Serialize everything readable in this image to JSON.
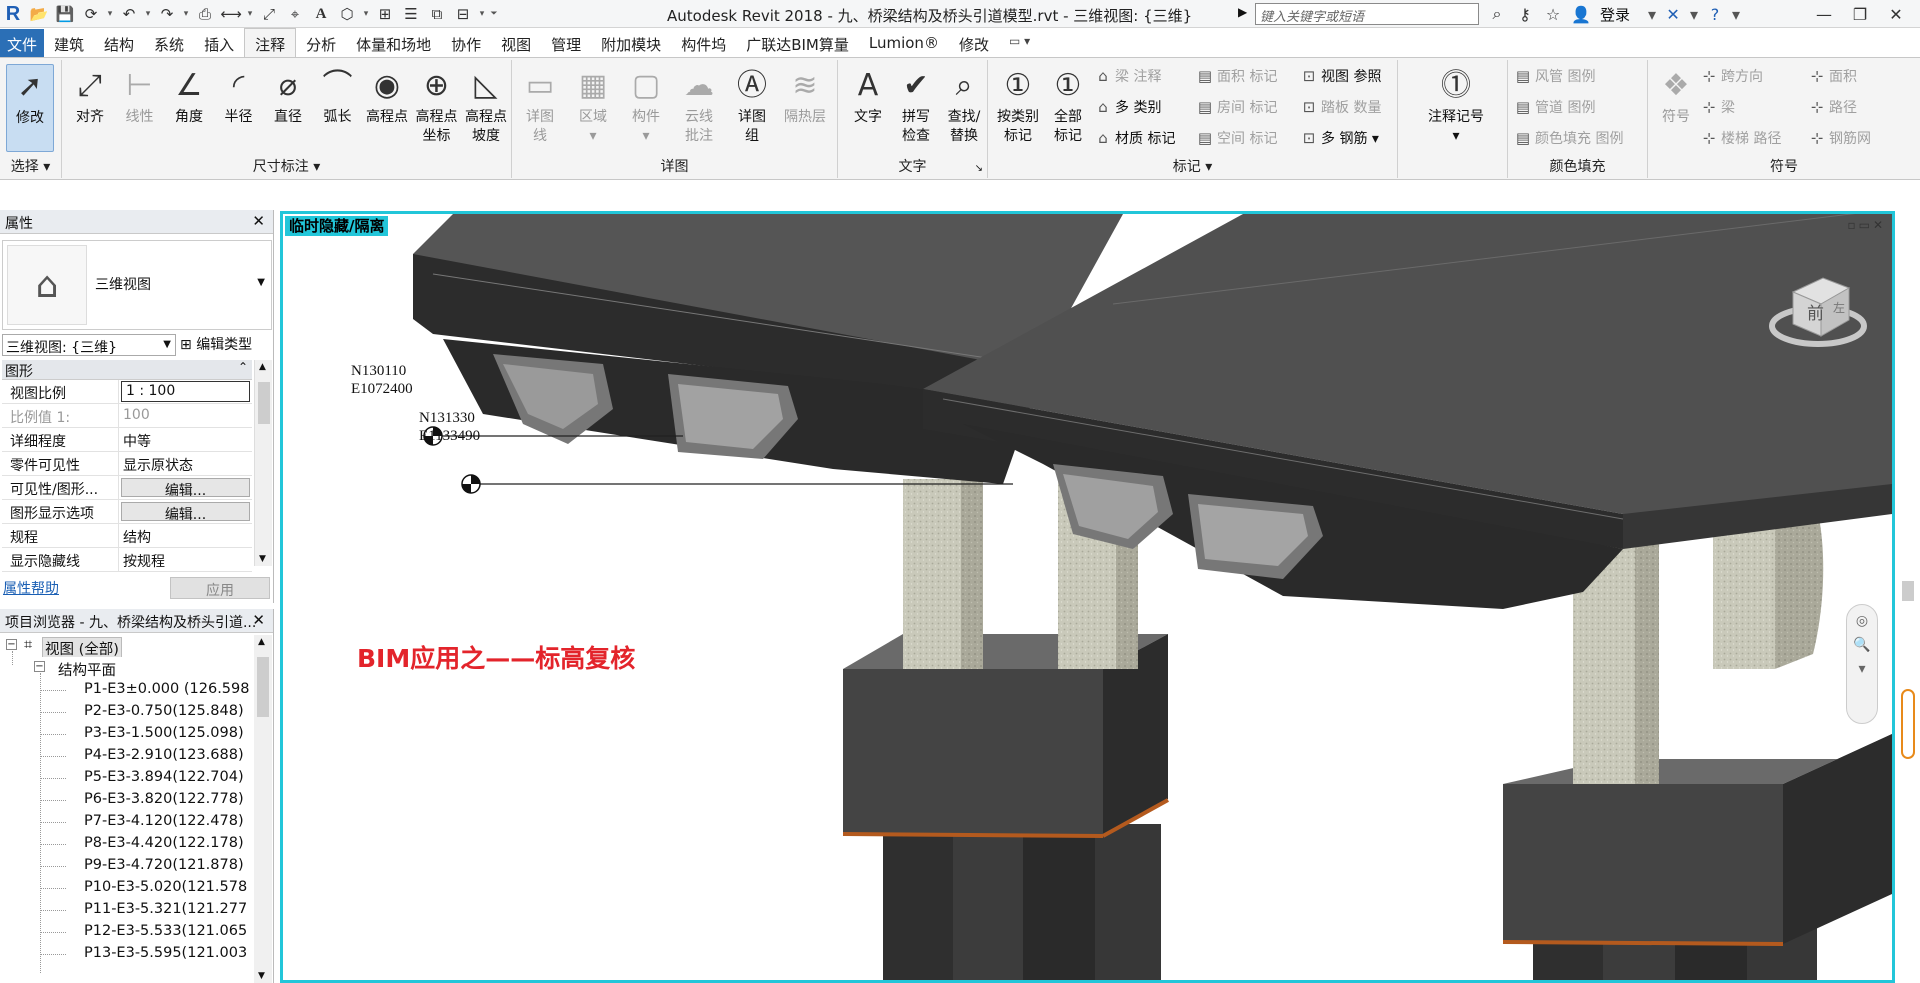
{
  "titlebar": {
    "app_title": "Autodesk Revit 2018 -    九、桥梁结构及桥头引道模型.rvt - 三维视图: {三维}",
    "search_placeholder": "键入关键字或短语",
    "login": "登录"
  },
  "tabs": [
    "文件",
    "建筑",
    "结构",
    "系统",
    "插入",
    "注释",
    "分析",
    "体量和场地",
    "协作",
    "视图",
    "管理",
    "附加模块",
    "构件坞",
    "广联达BIM算量",
    "Lumion®",
    "修改"
  ],
  "active_tab": "注释",
  "ribbon": {
    "select": {
      "label": "修改",
      "group": "选择 ▾"
    },
    "dimension": {
      "group": "尺寸标注 ▾",
      "buttons": [
        {
          "label": "对齐",
          "icon": "aligned-dimension-icon",
          "glyph": "⤢",
          "enabled": true
        },
        {
          "label": "线性",
          "icon": "linear-dimension-icon",
          "glyph": "⊢",
          "enabled": false
        },
        {
          "label": "角度",
          "icon": "angular-dimension-icon",
          "glyph": "∠",
          "enabled": true
        },
        {
          "label": "半径",
          "icon": "radial-dimension-icon",
          "glyph": "◜",
          "enabled": true
        },
        {
          "label": "直径",
          "icon": "diameter-dimension-icon",
          "glyph": "⌀",
          "enabled": true
        },
        {
          "label": "弧长",
          "icon": "arc-length-icon",
          "glyph": "⌒",
          "enabled": true
        },
        {
          "label": "高程点",
          "icon": "spot-elevation-icon",
          "glyph": "◉",
          "enabled": true
        },
        {
          "label": "高程点\n坐标",
          "icon": "spot-coordinate-icon",
          "glyph": "⊕",
          "enabled": true
        },
        {
          "label": "高程点\n坡度",
          "icon": "spot-slope-icon",
          "glyph": "◺",
          "enabled": true
        }
      ]
    },
    "detail": {
      "group": "详图",
      "buttons": [
        {
          "label": "详图\n线",
          "icon": "detail-line-icon",
          "glyph": "▭",
          "enabled": false
        },
        {
          "label": "区域\n▾",
          "icon": "region-icon",
          "glyph": "▦",
          "enabled": false
        },
        {
          "label": "构件\n▾",
          "icon": "component-icon",
          "glyph": "▢",
          "enabled": false
        },
        {
          "label": "云线\n批注",
          "icon": "revision-cloud-icon",
          "glyph": "☁",
          "enabled": false
        },
        {
          "label": "详图\n组",
          "icon": "detail-group-icon",
          "glyph": "Ⓐ",
          "enabled": true
        },
        {
          "label": "隔热层",
          "icon": "insulation-icon",
          "glyph": "≋",
          "enabled": false
        }
      ]
    },
    "text": {
      "group": "文字",
      "buttons": [
        {
          "label": "文字",
          "icon": "text-icon",
          "glyph": "A",
          "enabled": true
        },
        {
          "label": "拼写\n检查",
          "icon": "spelling-icon",
          "glyph": "✔",
          "enabled": true
        },
        {
          "label": "查找/\n替换",
          "icon": "find-replace-icon",
          "glyph": "⌕",
          "enabled": true
        }
      ]
    },
    "tag": {
      "group": "标记 ▾",
      "buttons": [
        {
          "label": "按类别\n标记",
          "icon": "tag-by-category-icon",
          "glyph": "①",
          "enabled": true
        },
        {
          "label": "全部\n标记",
          "icon": "tag-all-icon",
          "glyph": "①",
          "enabled": true
        }
      ],
      "col1": [
        {
          "label": "梁 注释",
          "enabled": false
        },
        {
          "label": "多 类别",
          "enabled": true
        },
        {
          "label": "材质 标记",
          "enabled": true
        }
      ],
      "col2": [
        {
          "label": "面积 标记",
          "enabled": false
        },
        {
          "label": "房间 标记",
          "enabled": false
        },
        {
          "label": "空间 标记",
          "enabled": false
        }
      ],
      "col3": [
        {
          "label": "视图 参照",
          "enabled": true
        },
        {
          "label": "踏板 数量",
          "enabled": false
        },
        {
          "label": "多 钢筋 ▾",
          "enabled": true
        }
      ]
    },
    "keynote": {
      "label": "注释记号\n▾",
      "glyph": "⓵"
    },
    "colorfill": {
      "group": "颜色填充",
      "items": [
        {
          "label": "风管 图例",
          "enabled": false
        },
        {
          "label": "管道 图例",
          "enabled": false
        },
        {
          "label": "颜色填充 图例",
          "enabled": false
        }
      ]
    },
    "symbol": {
      "group": "符号",
      "button": {
        "label": "符号",
        "glyph": "❖",
        "enabled": false
      },
      "col1": [
        {
          "label": "跨方向",
          "enabled": false
        },
        {
          "label": "梁",
          "enabled": false
        },
        {
          "label": "楼梯 路径",
          "enabled": false
        }
      ],
      "col2": [
        {
          "label": "面积",
          "enabled": false
        },
        {
          "label": "路径",
          "enabled": false
        },
        {
          "label": "钢筋网",
          "enabled": false
        }
      ]
    }
  },
  "properties": {
    "title": "属性",
    "type_name": "三维视图",
    "view_selector": "三维视图: {三维}",
    "edit_type": "编辑类型",
    "category": "图形",
    "rows": [
      {
        "key": "视图比例",
        "value": "1 : 100",
        "kind": "box",
        "enabled": true
      },
      {
        "key": "比例值 1:",
        "value": "100",
        "kind": "text",
        "enabled": false
      },
      {
        "key": "详细程度",
        "value": "中等",
        "kind": "text",
        "enabled": true
      },
      {
        "key": "零件可见性",
        "value": "显示原状态",
        "kind": "text",
        "enabled": true
      },
      {
        "key": "可见性/图形...",
        "value": "编辑...",
        "kind": "button",
        "enabled": true
      },
      {
        "key": "图形显示选项",
        "value": "编辑...",
        "kind": "button",
        "enabled": true
      },
      {
        "key": "规程",
        "value": "结构",
        "kind": "text",
        "enabled": true
      },
      {
        "key": "显示隐藏线",
        "value": "按规程",
        "kind": "text",
        "enabled": true
      }
    ],
    "help": "属性帮助",
    "apply": "应用"
  },
  "browser": {
    "title": "项目浏览器 - 九、桥梁结构及桥头引道...",
    "root": "视图 (全部)",
    "folder": "结构平面",
    "items": [
      "P1-E3±0.000  (126.598",
      "P2-E3-0.750(125.848)",
      "P3-E3-1.500(125.098)",
      "P4-E3-2.910(123.688)",
      "P5-E3-3.894(122.704)",
      "P6-E3-3.820(122.778)",
      "P7-E3-4.120(122.478)",
      "P8-E3-4.420(122.178)",
      "P9-E3-4.720(121.878)",
      "P10-E3-5.020(121.578",
      "P11-E3-5.321(121.277",
      "P12-E3-5.533(121.065",
      "P13-E3-5.595(121.003"
    ]
  },
  "viewport": {
    "isolate_label": "临时隐藏/隔离",
    "caption": "BIM应用之——标高复核",
    "coord1": {
      "n": "N130110",
      "e": "E1072400"
    },
    "coord2": {
      "n": "N131330",
      "e": "E1133490"
    },
    "viewcube_face": "前",
    "viewcube_side": "左"
  }
}
